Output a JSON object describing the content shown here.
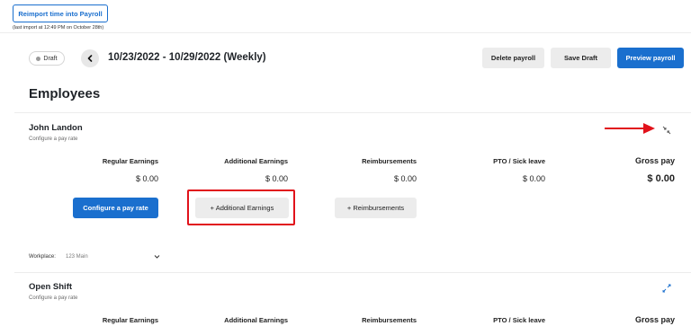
{
  "header": {
    "reimport_label": "Reimport time into Payroll",
    "last_import": "(last import at 12:49 PM on October 28th)"
  },
  "toolbar": {
    "status_badge": "Draft",
    "date_range": "10/23/2022 - 10/29/2022 (Weekly)",
    "delete_label": "Delete payroll",
    "save_label": "Save Draft",
    "preview_label": "Preview payroll"
  },
  "section_title": "Employees",
  "employees": [
    {
      "name": "John Landon",
      "subtitle": "Configure a pay rate",
      "columns": [
        "Regular Earnings",
        "Additional Earnings",
        "Reimbursements",
        "PTO / Sick leave",
        "Gross pay"
      ],
      "values": [
        "$ 0.00",
        "$ 0.00",
        "$ 0.00",
        "$ 0.00",
        "$ 0.00"
      ],
      "configure_label": "Configure a pay rate",
      "additional_earnings_label": "+ Additional Earnings",
      "reimbursements_label": "+ Reimbursements",
      "workplace_label": "Workplace:",
      "workplace_value": "123 Main"
    },
    {
      "name": "Open Shift",
      "subtitle": "Configure a pay rate",
      "columns": [
        "Regular Earnings",
        "Additional Earnings",
        "Reimbursements",
        "PTO / Sick leave",
        "Gross pay"
      ]
    }
  ],
  "colors": {
    "accent": "#1a6fce",
    "annotation": "#e1121b"
  },
  "icons": {
    "back": "chevron-left-icon",
    "collapse": "collapse-icon",
    "expand": "expand-icon",
    "dropdown": "chevron-down-icon"
  }
}
